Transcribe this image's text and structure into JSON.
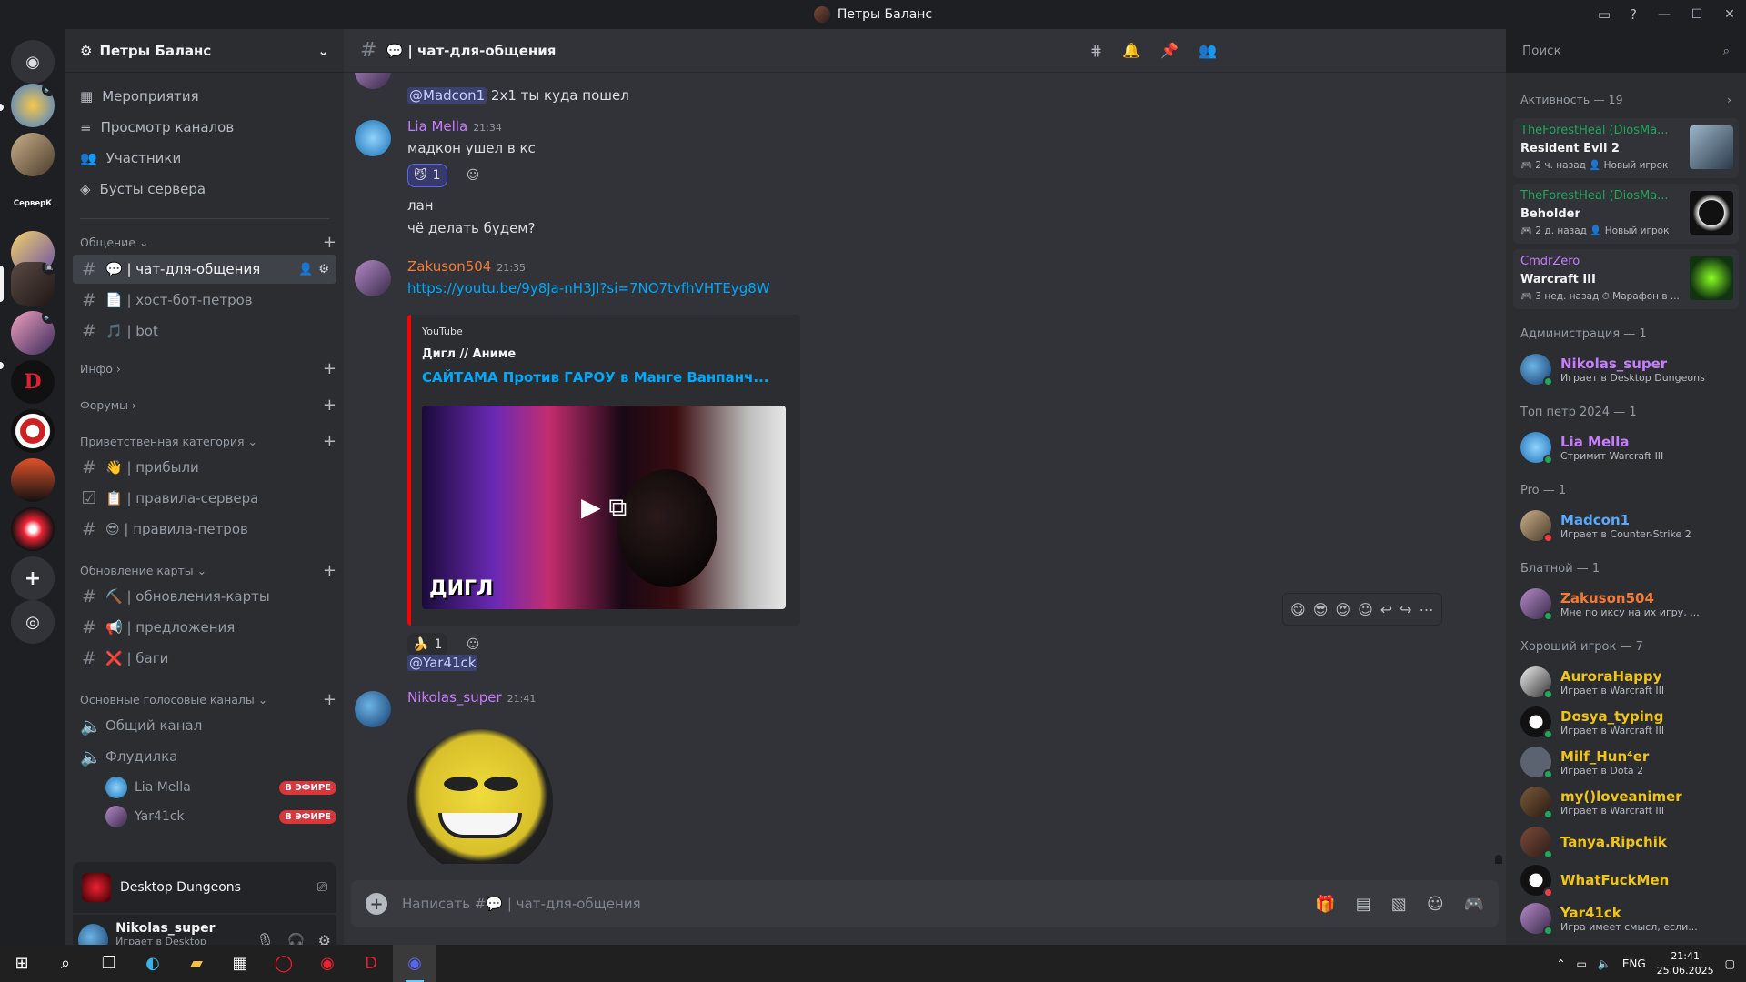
{
  "window": {
    "title": "Петры Баланс"
  },
  "guild": {
    "name": "Петры Баланс"
  },
  "rail": {
    "server_label": "СерверК"
  },
  "nav": [
    {
      "label": "Мероприятия",
      "icon": "calendar-icon"
    },
    {
      "label": "Просмотр каналов",
      "icon": "browse-icon"
    },
    {
      "label": "Участники",
      "icon": "members-icon"
    },
    {
      "label": "Бусты сервера",
      "icon": "boost-icon"
    }
  ],
  "categories": {
    "obshenie": "Общение",
    "info": "Инфо",
    "forums": "Форумы",
    "welcome": "Приветственная категория",
    "map": "Обновление карты",
    "voice": "Основные голосовые каналы"
  },
  "channels": {
    "chat": "💬 | чат-для-общения",
    "host": "📄 | хост-бот-петров",
    "bot": "🎵 | bot",
    "pribyli": "👋 | прибыли",
    "rules_server": "📋 | правила-сервера",
    "rules_petrov": "😎 | правила-петров",
    "map_updates": "⛏️ | обновления-карты",
    "suggestions": "📢 | предложения",
    "bugs": "❌ | баги",
    "general_voice": "Общий канал",
    "flood_voice": "Флудилка"
  },
  "voice_users": [
    {
      "name": "Lia Mella",
      "badge": "В ЭФИРЕ"
    },
    {
      "name": "Yar41ck",
      "badge": "В ЭФИРЕ"
    }
  ],
  "game_bar": {
    "title": "Desktop Dungeons"
  },
  "user": {
    "name": "Nikolas_super",
    "status": "Играет в Desktop Dungeons"
  },
  "chat": {
    "channel_name": "💬 | чат-для-общения",
    "search_placeholder": "Поиск",
    "composer_placeholder": "Написать #💬 | чат-для-общения"
  },
  "messages": {
    "m0_mention": "@Madcon1",
    "m0_text": "2x1 ты куда пошел",
    "m1_author": "Lia Mella",
    "m1_time": "21:34",
    "m1_line1": "мадкон ушел в кс",
    "m1_react_count": "1",
    "m1_line2": "лан",
    "m1_line3": "чё делать будем?",
    "m2_author": "Zakuson504",
    "m2_time": "21:35",
    "m2_link": "https://youtu.be/9y8Ja-nH3JI?si=7NO7tvfhVHTEyg8W",
    "embed_provider": "YouTube",
    "embed_author": "Дигл // Аниме",
    "embed_title": "САЙТАМА Против ГАРОУ в Манге Ванпанч...",
    "embed_caption": "ДИГЛ",
    "m2_react_count": "1",
    "m2_mention": "@Yar41ck",
    "m3_author": "Nikolas_super",
    "m3_time": "21:41"
  },
  "activity": {
    "header": "Активность — 19",
    "cards": [
      {
        "user": "TheForestHeal (DiosMa...",
        "game": "Resident Evil 2",
        "meta": "🎮 2 ч. назад  👤 Новый игрок"
      },
      {
        "user": "TheForestHeal (DiosMa...",
        "game": "Beholder",
        "meta": "🎮 2 д. назад  👤 Новый игрок"
      },
      {
        "user": "CmdrZero",
        "game": "Warcraft III",
        "meta": "🎮 3 нед. назад  ⏱ Марафон в ..."
      }
    ]
  },
  "member_groups": [
    {
      "title": "Администрация — 1"
    },
    {
      "title": "Топ петр 2024 — 1"
    },
    {
      "title": "Pro — 1"
    },
    {
      "title": "Блатной — 1"
    },
    {
      "title": "Хороший игрок — 7"
    }
  ],
  "members": [
    {
      "name": "Nikolas_super",
      "status": "Играет в Desktop Dungeons",
      "color": "#c77dff"
    },
    {
      "name": "Lia Mella",
      "status": "Стримит Warcraft III",
      "color": "#c77dff"
    },
    {
      "name": "Madcon1",
      "status": "Играет в Counter-Strike 2",
      "color": "#5aa9ff"
    },
    {
      "name": "Zakuson504",
      "status": "Мне по иксу на их игру, ...",
      "color": "#f47b36"
    },
    {
      "name": "AuroraHappy",
      "status": "Играет в Warcraft III",
      "color": "#f0c419"
    },
    {
      "name": "Dosya_typing",
      "status": "Играет в Warcraft III",
      "color": "#f0c419"
    },
    {
      "name": "Milf_Hun⁴er",
      "status": "Играет в Dota 2",
      "color": "#f0c419"
    },
    {
      "name": "my()loveanimer",
      "status": "Играет в Warcraft III",
      "color": "#f0c419"
    },
    {
      "name": "Tanya.Ripchik",
      "status": "",
      "color": "#f0c419"
    },
    {
      "name": "WhatFuckMen",
      "status": "",
      "color": "#f0c419"
    },
    {
      "name": "Yar41ck",
      "status": "Игра имеет смысл, если...",
      "color": "#f0c419"
    }
  ],
  "taskbar": {
    "lang": "ENG",
    "time": "21:41",
    "date": "25.06.2025"
  }
}
